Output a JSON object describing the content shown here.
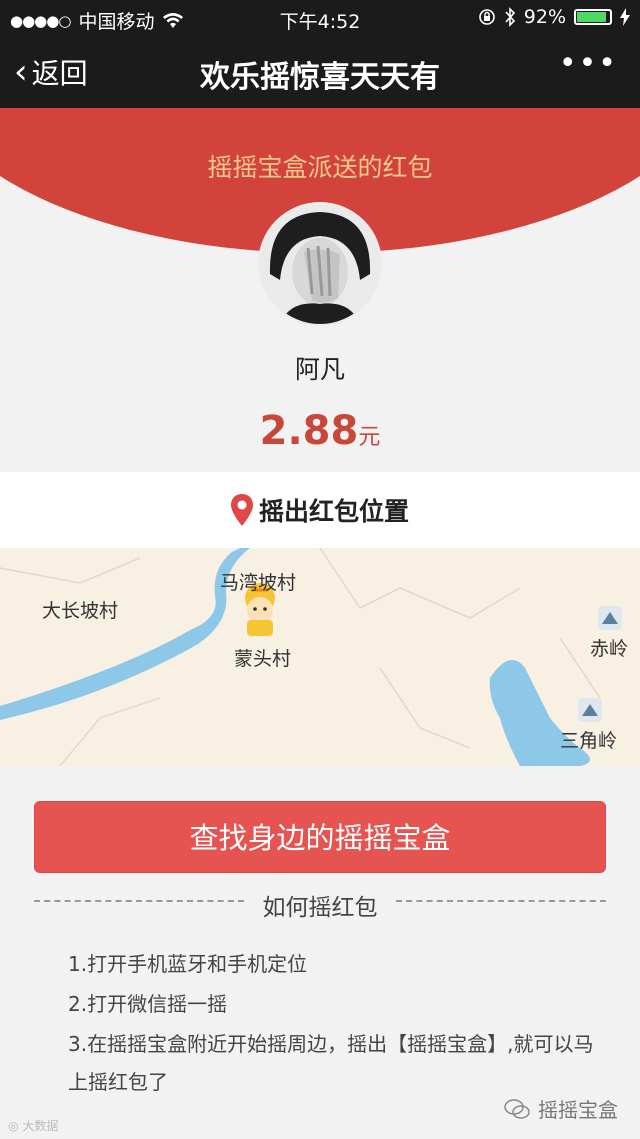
{
  "status_bar": {
    "carrier": "中国移动",
    "time": "下午4:52",
    "battery": "92%"
  },
  "nav": {
    "back_label": "返回",
    "title": "欢乐摇惊喜天天有",
    "more_icon": "more-dots-icon"
  },
  "banner": {
    "subtitle": "摇摇宝盒派送的红包",
    "color": "#d2443b"
  },
  "sender": {
    "name": "阿凡"
  },
  "amount": {
    "value": "2.88",
    "unit": "元",
    "color": "#c8473b"
  },
  "location": {
    "header": "摇出红包位置",
    "icon": "location-pin-icon",
    "map_places": [
      "马湾坡村",
      "大长坡村",
      "蒙头村",
      "赤岭",
      "三角岭"
    ]
  },
  "actions": {
    "find_button": "查找身边的摇摇宝盒",
    "button_color": "#e55451"
  },
  "howto": {
    "title": "如何摇红包",
    "steps": [
      "1.打开手机蓝牙和手机定位",
      "2.打开微信摇一摇",
      "3.在摇摇宝盒附近开始摇周边，摇出【摇摇宝盒】,就可以马上摇红包了"
    ]
  },
  "watermark": {
    "left": "大数据",
    "right": "摇摇宝盒"
  }
}
